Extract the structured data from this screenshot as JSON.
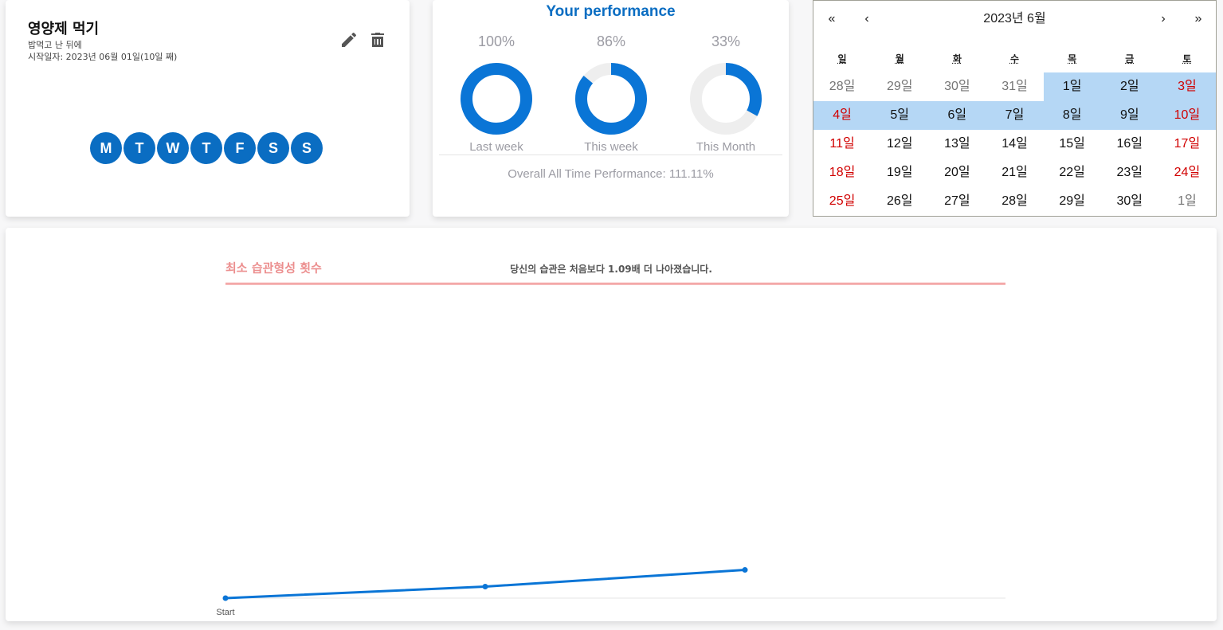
{
  "habit": {
    "title": "영양제 먹기",
    "description": "밥먹고 난 뒤에",
    "start_text": "시작일자: 2023년 06월 01일(10일 째)",
    "edit_icon": "pencil-icon",
    "delete_icon": "trash-icon",
    "days": [
      "M",
      "T",
      "W",
      "T",
      "F",
      "S",
      "S"
    ]
  },
  "performance": {
    "title": "Your performance",
    "items": [
      {
        "percent_text": "100%",
        "value": 1.0,
        "label": "Last week"
      },
      {
        "percent_text": "86%",
        "value": 0.86,
        "label": "This week"
      },
      {
        "percent_text": "33%",
        "value": 0.33,
        "label": "This Month"
      }
    ],
    "overall": "Overall All Time Performance: 111.11%",
    "colors": {
      "ring": "#0a75d6",
      "track": "#eeeeee"
    }
  },
  "calendar": {
    "label": "2023년 6월",
    "nav": {
      "prev2": "«",
      "prev": "‹",
      "next": "›",
      "next2": "»"
    },
    "weekdays": [
      "일",
      "월",
      "화",
      "수",
      "목",
      "금",
      "토"
    ],
    "days": [
      {
        "t": "28일",
        "s": "muted"
      },
      {
        "t": "29일",
        "s": "muted"
      },
      {
        "t": "30일",
        "s": "muted"
      },
      {
        "t": "31일",
        "s": "muted"
      },
      {
        "t": "1일",
        "s": "hl"
      },
      {
        "t": "2일",
        "s": "hl"
      },
      {
        "t": "3일",
        "s": "red hl"
      },
      {
        "t": "4일",
        "s": "red hl"
      },
      {
        "t": "5일",
        "s": "hl"
      },
      {
        "t": "6일",
        "s": "hl"
      },
      {
        "t": "7일",
        "s": "hl"
      },
      {
        "t": "8일",
        "s": "hl"
      },
      {
        "t": "9일",
        "s": "hl"
      },
      {
        "t": "10일",
        "s": "red hl"
      },
      {
        "t": "11일",
        "s": "red"
      },
      {
        "t": "12일",
        "s": ""
      },
      {
        "t": "13일",
        "s": ""
      },
      {
        "t": "14일",
        "s": ""
      },
      {
        "t": "15일",
        "s": ""
      },
      {
        "t": "16일",
        "s": ""
      },
      {
        "t": "17일",
        "s": "red"
      },
      {
        "t": "18일",
        "s": "red"
      },
      {
        "t": "19일",
        "s": ""
      },
      {
        "t": "20일",
        "s": ""
      },
      {
        "t": "21일",
        "s": ""
      },
      {
        "t": "22일",
        "s": ""
      },
      {
        "t": "23일",
        "s": ""
      },
      {
        "t": "24일",
        "s": "red"
      },
      {
        "t": "25일",
        "s": "red"
      },
      {
        "t": "26일",
        "s": ""
      },
      {
        "t": "27일",
        "s": ""
      },
      {
        "t": "28일",
        "s": ""
      },
      {
        "t": "29일",
        "s": ""
      },
      {
        "t": "30일",
        "s": ""
      },
      {
        "t": "1일",
        "s": "muted"
      }
    ],
    "colors": {
      "highlight": "#b5d7f5",
      "weekend": "#d10000"
    }
  },
  "chart_message": "당신의 습관은 처음보다 1.09배 더 나아졌습니다.",
  "chart_data": {
    "type": "line",
    "x": [
      "Start",
      "",
      ""
    ],
    "series": [
      {
        "values": [
          0,
          0.9,
          2.2
        ]
      }
    ],
    "reference_line": {
      "label": "최소 습관형성 횟수",
      "value": 24.5,
      "color": "#f4a9a9"
    },
    "ylim": [
      0,
      27
    ],
    "line_color": "#0a75d6"
  }
}
